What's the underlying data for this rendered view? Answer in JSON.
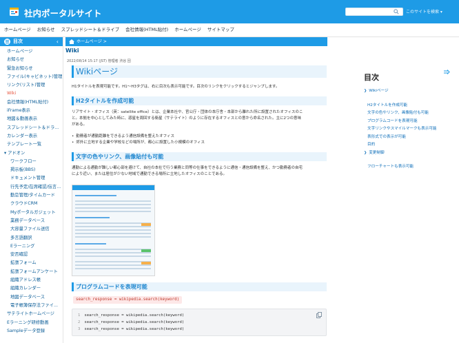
{
  "header": {
    "title": "社内ポータルサイト",
    "search_placeholder": "",
    "search_hint": "このサイトを検索 ▾",
    "brand_color": "#1e9be6"
  },
  "global_nav": [
    "ホームページ",
    "お知らせ",
    "スプレッドシート＆ドライブ",
    "会社情報(HTML貼付)",
    "ホームページ",
    "サイトマップ"
  ],
  "sidebar": {
    "toc_label": "目次",
    "items": [
      {
        "label": "ホームページ",
        "type": "top"
      },
      {
        "label": "お知らせ",
        "type": "top"
      },
      {
        "label": "緊急お知らせ",
        "type": "top"
      },
      {
        "label": "ファイル(キャビネット)管理",
        "type": "top"
      },
      {
        "label": "リンク(リスト)管理",
        "type": "top"
      },
      {
        "label": "Wiki",
        "type": "active"
      },
      {
        "label": "会社情報(HTML貼付)",
        "type": "top"
      },
      {
        "label": "iFrame表示",
        "type": "top"
      },
      {
        "label": "地図＆動画表示",
        "type": "top"
      },
      {
        "label": "スプレッドシート＆ドラ...",
        "type": "top"
      },
      {
        "label": "カレンダー表示",
        "type": "top"
      },
      {
        "label": "テンプレート一覧",
        "type": "top"
      },
      {
        "label": "▾ アドオン",
        "type": "group"
      },
      {
        "label": "ワークフロー",
        "type": "sub"
      },
      {
        "label": "掲示板(BBS)",
        "type": "sub"
      },
      {
        "label": "ドキュメント管理",
        "type": "sub"
      },
      {
        "label": "行先予定/在席確認/伝言...",
        "type": "sub"
      },
      {
        "label": "勤怠管理/タイムカード",
        "type": "sub"
      },
      {
        "label": "クラウドCRM",
        "type": "sub"
      },
      {
        "label": "Myポータルガジェット",
        "type": "sub"
      },
      {
        "label": "業務データベース",
        "type": "sub"
      },
      {
        "label": "大容量ファイル送信",
        "type": "sub"
      },
      {
        "label": "多言語翻訳",
        "type": "sub"
      },
      {
        "label": "Eラーニング",
        "type": "sub"
      },
      {
        "label": "安否確認",
        "type": "sub"
      },
      {
        "label": "拡張フォーム",
        "type": "sub"
      },
      {
        "label": "拡張フォームアンケート",
        "type": "sub"
      },
      {
        "label": "組織アドレス帳",
        "type": "sub"
      },
      {
        "label": "組織カレンダー",
        "type": "sub"
      },
      {
        "label": "地図データベース",
        "type": "sub"
      },
      {
        "label": "電子帳簿保存法ファイ...",
        "type": "sub"
      },
      {
        "label": "サテライトホームページ",
        "type": "top"
      },
      {
        "label": "Eラーニング研修動画",
        "type": "top"
      },
      {
        "label": "Sampleデータ登録",
        "type": "top"
      }
    ]
  },
  "breadcrumb": {
    "text": "ホームページ >"
  },
  "page": {
    "small_title": "Wiki",
    "meta": "2022/08/14 15:17 (JST)  管理者 渋谷 団",
    "h1": "Wikiページ",
    "p1": "H1タイトルを表現可能です。H1〜H3タグは、右に目次も表示可能です。目次のリンクをクリックするとジャンプします。",
    "h2a": "H2タイトルを作成可能",
    "p2a": "リアサイト・オフィス（英：satellite office）とは、企業本社や、官公庁・団体の本庁舎・本部から離れた所に設置されたオフィスのこ",
    "p2b": "と。本拠を中心としてみた時に、惑星を周回する衛星（サテライト）のように存在するオフィスとの意から命名された。主に2つの意味",
    "p2c": "がある。",
    "bullets": [
      "勤務者が通勤距離をできるよう通信設備を整えたオフィス",
      "郊外に立地する企業や学校などの場所が、都心に設置した小規模のオフィス"
    ],
    "h2b": "文字の色やリンク、画像貼付も可能",
    "p3a": "通勤による通勤が難しい都心部を避けて、自社の本社で行う業務と同等の仕事をできるように通信・通信設備を整え、かつ勤務者の自宅",
    "p3b": "により近い、または居住が少ない地域で通勤できる場所に立地したオフィスのことである。",
    "h2c": "プログラムコードを表現可能",
    "code_inline": "search_response = wikipedia.search(keyword)",
    "code_lines": [
      {
        "num": "1",
        "text": "search_response = wikipedia.search(keyword)"
      },
      {
        "num": "2",
        "text": "search_response = wikipedia.search(keyword)"
      },
      {
        "num": "3",
        "text": "search_response = wikipedia.search(keyword)"
      }
    ]
  },
  "right_toc": {
    "title": "目次",
    "items": [
      {
        "label": "Wikiページ",
        "level": "l1",
        "chev": "❯"
      },
      {
        "label": "H2タイトルを作成可能",
        "level": "l2",
        "chev": "",
        "spacer": true
      },
      {
        "label": "文字の色やリンク、画像貼付も可能",
        "level": "l2",
        "chev": ""
      },
      {
        "label": "プログラムコードを表現可能",
        "level": "l2",
        "chev": ""
      },
      {
        "label": "文字リンクやスマイルマークも表示可能",
        "level": "l2",
        "chev": ""
      },
      {
        "label": "表形式での表示が可能",
        "level": "l2",
        "chev": ""
      },
      {
        "label": "目的",
        "level": "l2",
        "chev": ""
      },
      {
        "label": "変更制御",
        "level": "l1",
        "chev": "❯"
      },
      {
        "label": "フローチャートも表示可能",
        "level": "l2",
        "chev": "",
        "spacer": true
      }
    ]
  }
}
